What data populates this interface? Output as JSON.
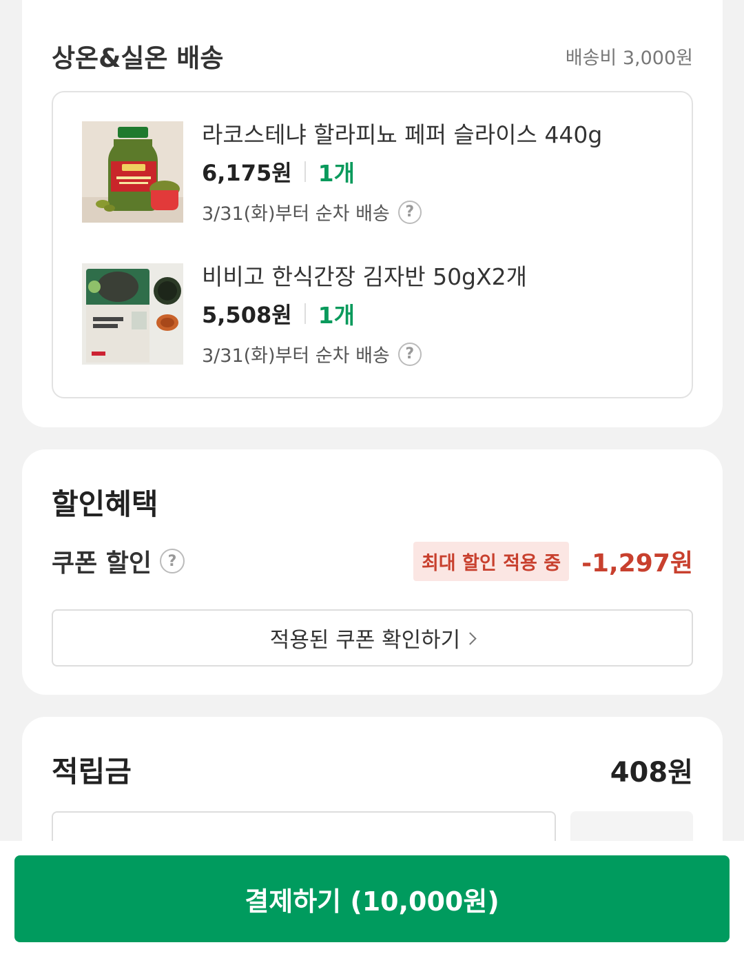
{
  "shipping": {
    "title": "상온&실온 배송",
    "fee": "배송비 3,000원",
    "items": [
      {
        "name": "라코스테냐 할라피뇨 페퍼 슬라이스 440g",
        "price": "6,175원",
        "qty": "1개",
        "delivery": "3/31(화)부터 순차 배송",
        "help_icon": "question-icon"
      },
      {
        "name": "비비고 한식간장 김자반 50gX2개",
        "price": "5,508원",
        "qty": "1개",
        "delivery": "3/31(화)부터 순차 배송",
        "help_icon": "question-icon"
      }
    ]
  },
  "discount": {
    "title": "할인혜택",
    "coupon_label": "쿠폰 할인",
    "badge": "최대 할인 적용 중",
    "amount": "-1,297원",
    "view_coupons_label": "적용된 쿠폰 확인하기"
  },
  "points": {
    "title": "적립금",
    "amount": "408원"
  },
  "checkout": {
    "pay_label": "결제하기 (10,000원)"
  },
  "colors": {
    "accent_green": "#009b5e",
    "qty_green": "#0a9a5c",
    "discount_red": "#c8402e",
    "badge_bg": "#fbe6e3"
  }
}
